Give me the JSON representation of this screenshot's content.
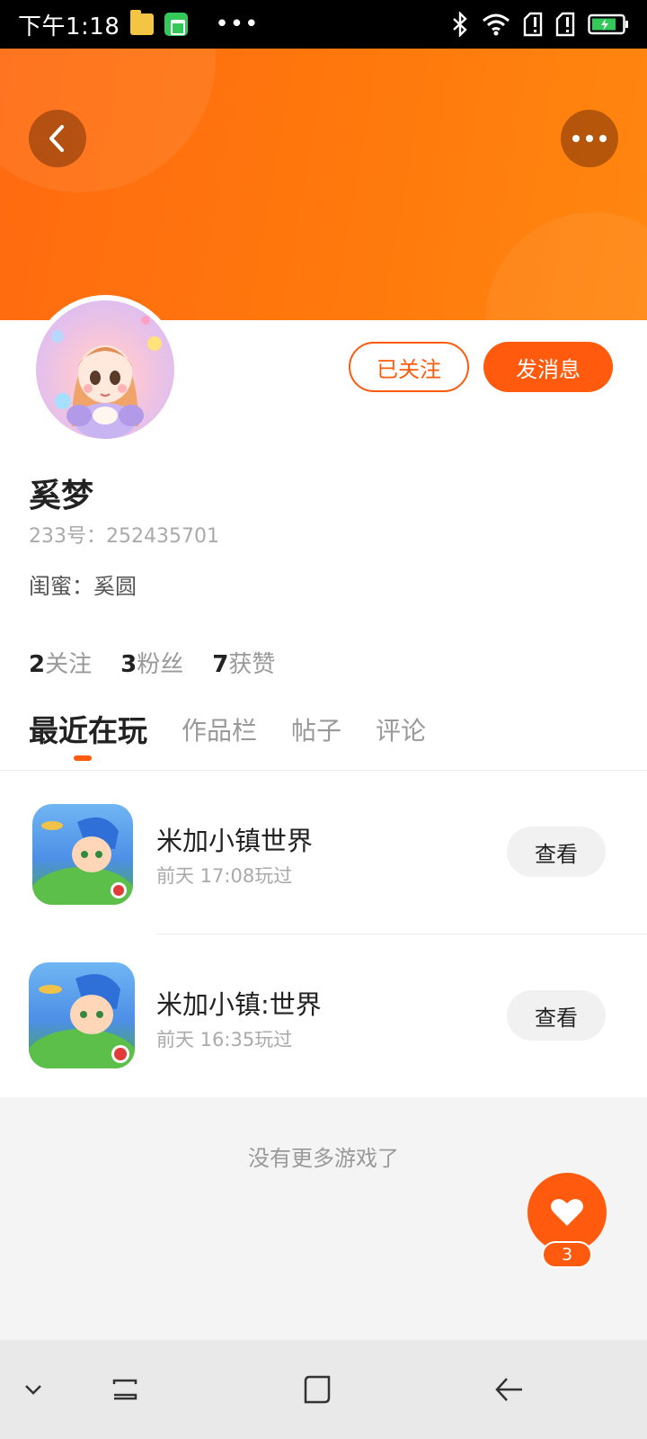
{
  "status_bar": {
    "time": "下午1:18",
    "icons": [
      "folder-icon",
      "android-icon",
      "more-dots-icon",
      "bluetooth-icon",
      "wifi-icon",
      "sim1-icon",
      "sim2-icon",
      "battery-icon"
    ],
    "dots": "•••"
  },
  "header": {
    "back_icon": "chevron-left-icon",
    "more_icon": "more-horizontal-icon",
    "accent_color": "#ff6a10"
  },
  "profile": {
    "name": "奚梦",
    "id_text": "233号：252435701",
    "bestie_text": "闺蜜：奚圆",
    "follow_button": "已关注",
    "message_button": "发消息"
  },
  "stats": [
    {
      "num": "2",
      "label": "关注"
    },
    {
      "num": "3",
      "label": "粉丝"
    },
    {
      "num": "7",
      "label": "获赞"
    }
  ],
  "tabs": [
    {
      "label": "最近在玩",
      "active": true
    },
    {
      "label": "作品栏",
      "active": false
    },
    {
      "label": "帖子",
      "active": false
    },
    {
      "label": "评论",
      "active": false
    }
  ],
  "games": [
    {
      "title": "米加小镇世界",
      "time": "前天 17:08玩过",
      "button": "查看"
    },
    {
      "title": "米加小镇:世界",
      "time": "前天 16:35玩过",
      "button": "查看"
    }
  ],
  "footer": {
    "no_more": "没有更多游戏了"
  },
  "fab": {
    "icon": "heart-icon",
    "count": "3"
  },
  "nav_bar": {
    "icons": [
      "chevron-down-icon",
      "recent-apps-icon",
      "home-icon",
      "back-icon"
    ]
  }
}
